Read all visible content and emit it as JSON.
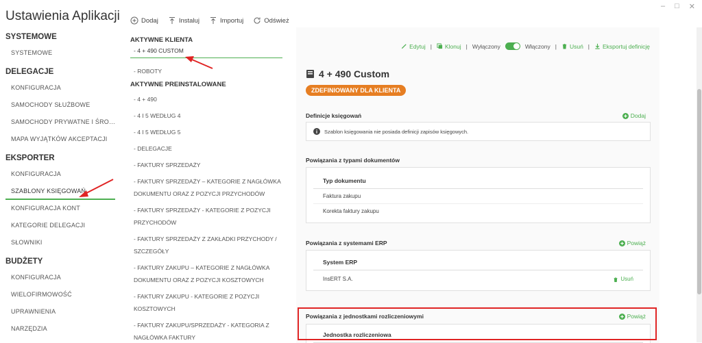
{
  "window": {
    "minimize": "–",
    "maximize": "□",
    "close": "✕"
  },
  "app_title": "Ustawienia Aplikacji",
  "nav": [
    {
      "section": "SYSTEMOWE",
      "items": [
        "SYSTEMOWE"
      ]
    },
    {
      "section": "DELEGACJE",
      "items": [
        "KONFIGURACJA",
        "SAMOCHODY SŁUŻBOWE",
        "SAMOCHODY PRYWATNE I ŚROD…",
        "MAPA WYJĄTKÓW AKCEPTACJI"
      ]
    },
    {
      "section": "EKSPORTER",
      "items": [
        "KONFIGURACJA",
        "SZABLONY KSIĘGOWAŃ",
        "KONFIGURACJA KONT",
        "KATEGORIE DELEGACJI",
        "SŁOWNIKI"
      ]
    },
    {
      "section": "BUDŻETY",
      "items": [
        "KONFIGURACJA",
        "WIELOFIRMOWOŚĆ",
        "UPRAWNIENIA",
        "NARZĘDZIA"
      ]
    }
  ],
  "toolbar": {
    "add": "Dodaj",
    "install": "Instaluj",
    "import": "Importuj",
    "refresh": "Odśwież"
  },
  "templates": {
    "client_group": "AKTYWNE KLIENTA",
    "client_items": [
      "4 + 490 CUSTOM",
      "ROBOTY"
    ],
    "preinstalled_group": "AKTYWNE PREINSTALOWANE",
    "preinstalled_items": [
      "4 + 490",
      "4 I 5 WEDŁUG 4",
      "4 I 5 WEDŁUG 5",
      "DELEGACJE",
      "FAKTURY SPRZEDAŻY",
      "FAKTURY SPRZEDAŻY – KATEGORIE Z NAGŁÓWKA DOKUMENTU ORAZ Z POZYCJI PRZYCHODÓW",
      "FAKTURY SPRZEDAŻY - KATEGORIE Z POZYCJI PRZYCHODÓW",
      "FAKTURY SPRZEDAŻY Z ZAKŁADKI PRZYCHODY / SZCZEGÓŁY",
      "FAKTURY ZAKUPU – KATEGORIE Z NAGŁÓWKA DOKUMENTU ORAZ Z POZYCJI KOSZTOWYCH",
      "FAKTURY ZAKUPU - KATEGORIE Z POZYCJI KOSZTOWYCH",
      "FAKTURY ZAKUPU/SPRZEDAŻY - KATEGORIA Z NAGŁÓWKA FAKTURY"
    ]
  },
  "actions": {
    "edit": "Edytuj",
    "clone": "Klonuj",
    "off": "Wyłączony",
    "on": "Włączony",
    "delete": "Usuń",
    "export": "Eksportuj definicję",
    "sep": "|"
  },
  "detail": {
    "title": "4 + 490 Custom",
    "badge": "ZDEFINIOWANY DLA KLIENTA",
    "definitions_title": "Definicje księgowań",
    "definitions_add": "Dodaj",
    "definitions_info": "Szablon księgowania nie posiada definicji zapisów księgowych.",
    "doc_types_title": "Powiązania z typami dokumentów",
    "doc_types_header": "Typ dokumentu",
    "doc_types_rows": [
      "Faktura zakupu",
      "Korekta faktury zakupu"
    ],
    "erp_title": "Powiązania z systemami ERP",
    "erp_link": "Powiąż",
    "erp_header": "System ERP",
    "erp_rows": [
      "InsERT S.A."
    ],
    "erp_delete": "Usuń",
    "units_title": "Powiązania z jednostkami rozliczeniowymi",
    "units_link": "Powiąż",
    "units_header": "Jednostka rozliczeniowa"
  },
  "colors": {
    "accent": "#4caf50",
    "badge": "#e67e22",
    "highlight": "#e02424"
  }
}
